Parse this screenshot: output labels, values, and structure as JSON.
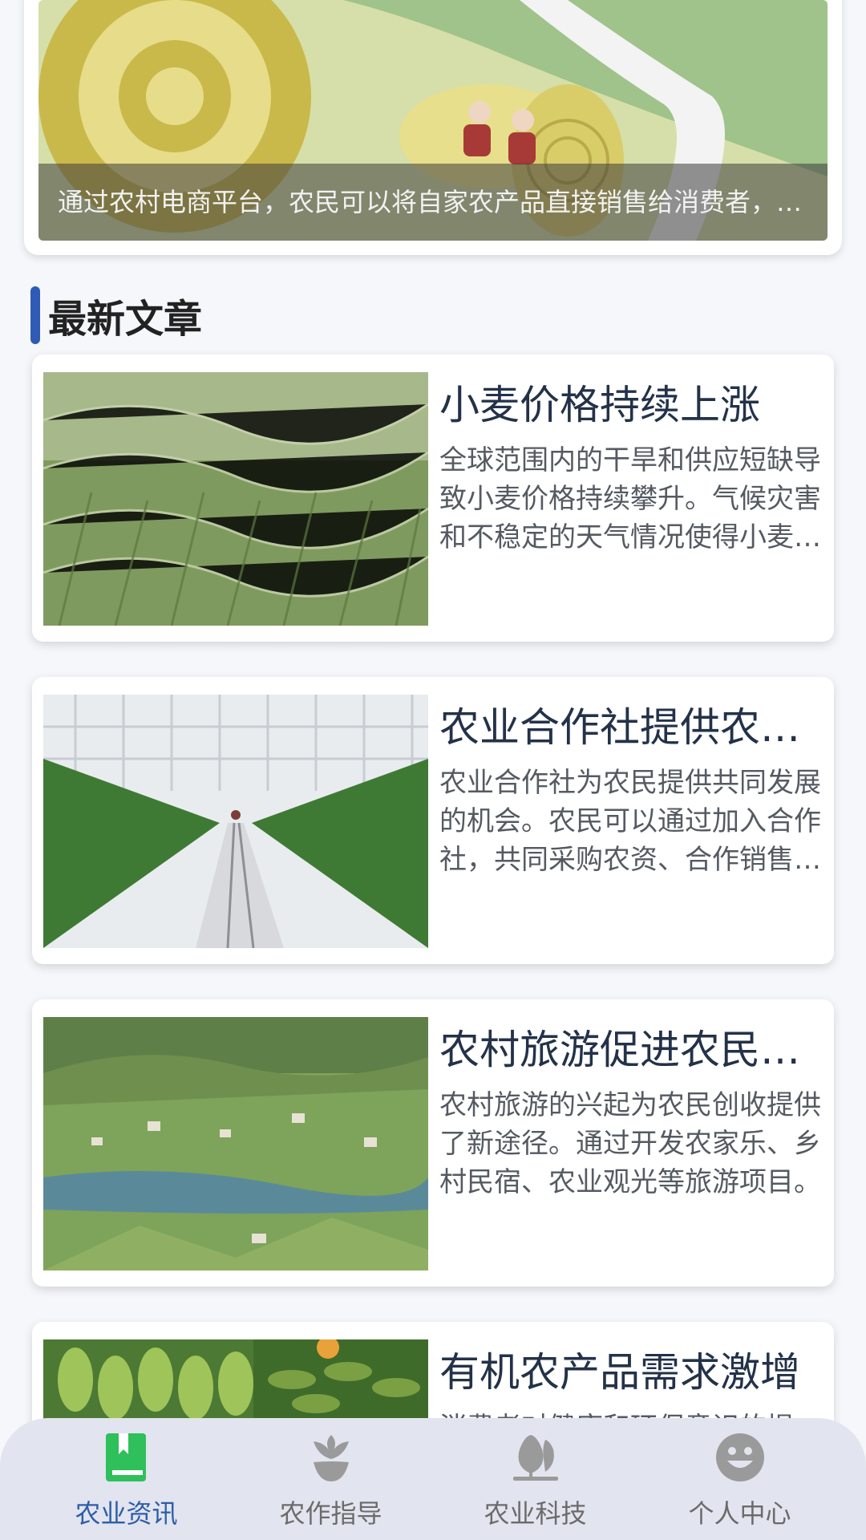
{
  "banner": {
    "caption": "通过农村电商平台，农民可以将自家农产品直接销售给消费者，减少中间环节，提高收入。"
  },
  "section": {
    "title": "最新文章"
  },
  "articles": [
    {
      "title": "小麦价格持续上涨",
      "desc": "全球范围内的干旱和供应短缺导致小麦价格持续攀升。气候灾害和不稳定的天气情况使得小麦产量下降。"
    },
    {
      "title": "农业合作社提供农民新机遇",
      "desc": "农业合作社为农民提供共同发展的机会。农民可以通过加入合作社，共同采购农资、合作销售农产品。"
    },
    {
      "title": "农村旅游促进农民增收",
      "desc": "农村旅游的兴起为农民创收提供了新途径。通过开发农家乐、乡村民宿、农业观光等旅游项目。"
    },
    {
      "title": "有机农产品需求激增",
      "desc": "消费者对健康和环保意识的提"
    }
  ],
  "nav": {
    "items": [
      {
        "label": "农业资讯",
        "icon": "book-icon"
      },
      {
        "label": "农作指导",
        "icon": "sprout-icon"
      },
      {
        "label": "农业科技",
        "icon": "tree-icon"
      },
      {
        "label": "个人中心",
        "icon": "smiley-icon"
      }
    ],
    "active_color": "#2e5da8",
    "active_icon_color": "#2fbf5b",
    "inactive_color": "#9a9a9a"
  }
}
